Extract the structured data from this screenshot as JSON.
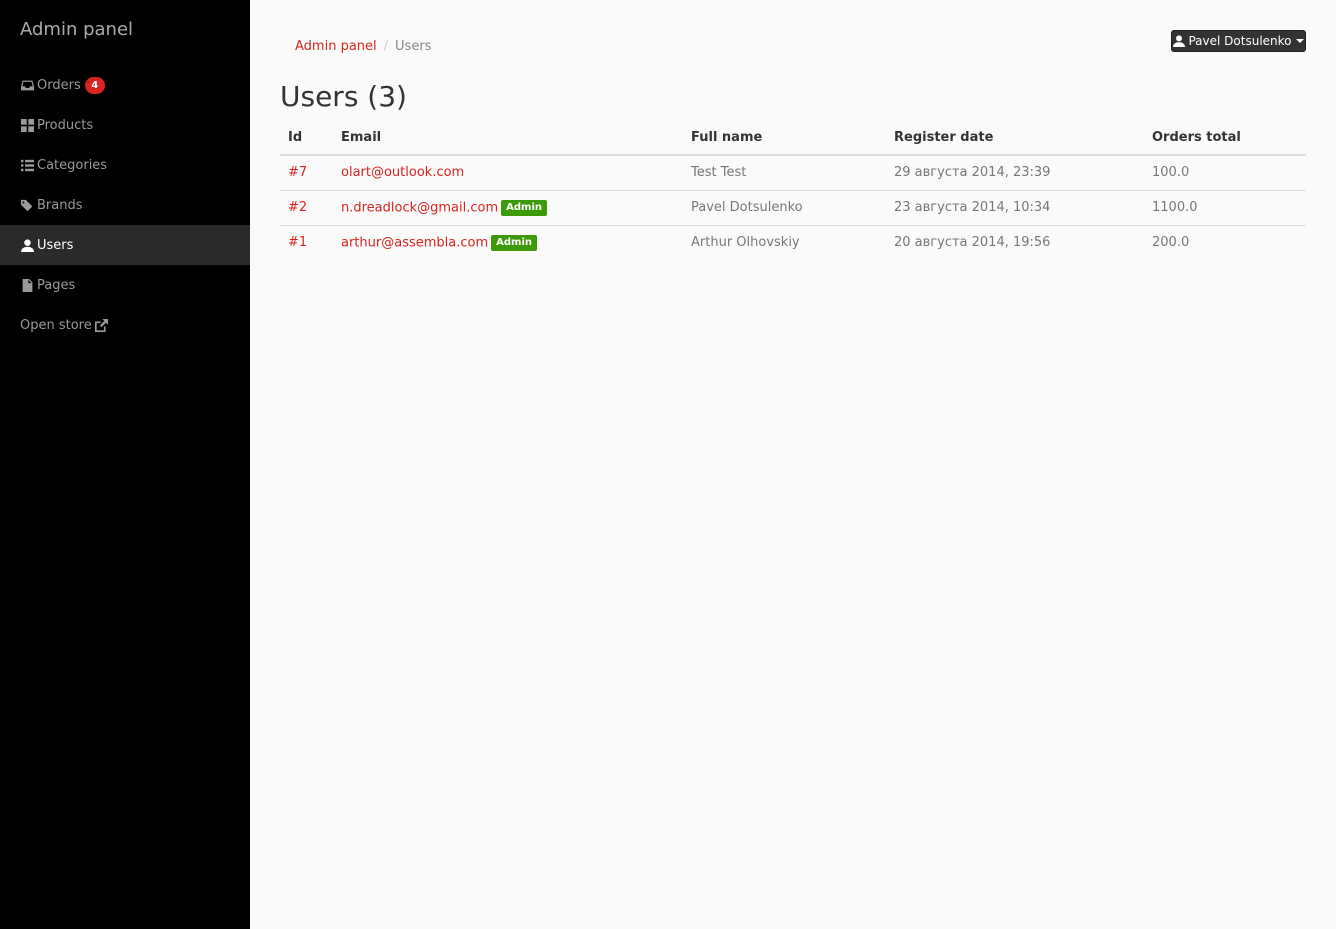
{
  "sidebar": {
    "brand": "Admin panel",
    "items": [
      {
        "label": "Orders",
        "icon": "inbox-icon",
        "badge": "4"
      },
      {
        "label": "Products",
        "icon": "th-large-icon"
      },
      {
        "label": "Categories",
        "icon": "list-icon"
      },
      {
        "label": "Brands",
        "icon": "tags-icon"
      },
      {
        "label": "Users",
        "icon": "user-icon",
        "active": true
      },
      {
        "label": "Pages",
        "icon": "file-icon"
      },
      {
        "label": "Open store",
        "icon": "external-link-icon"
      }
    ]
  },
  "breadcrumb": {
    "root": "Admin panel",
    "separator": "/",
    "current": "Users"
  },
  "user_menu": {
    "name": "Pavel Dotsulenko",
    "icon": "user-icon"
  },
  "page": {
    "title": "Users (3)"
  },
  "table": {
    "columns": [
      "Id",
      "Email",
      "Full name",
      "Register date",
      "Orders total"
    ],
    "rows": [
      {
        "id": "#7",
        "email": "olart@outlook.com",
        "role": "",
        "name": "Test Test",
        "date": "29 августа 2014, 23:39",
        "total": "100.0"
      },
      {
        "id": "#2",
        "email": "n.dreadlock@gmail.com",
        "role": "Admin",
        "name": "Pavel Dotsulenko",
        "date": "23 августа 2014, 10:34",
        "total": "1100.0"
      },
      {
        "id": "#1",
        "email": "arthur@assembla.com",
        "role": "Admin",
        "name": "Arthur Olhovskiy",
        "date": "20 августа 2014, 19:56",
        "total": "200.0"
      }
    ]
  },
  "colors": {
    "accent": "#d9231e",
    "admin_badge": "#3c9a09",
    "sidebar_bg": "#000000",
    "active_item_bg": "#2a2a2a"
  }
}
